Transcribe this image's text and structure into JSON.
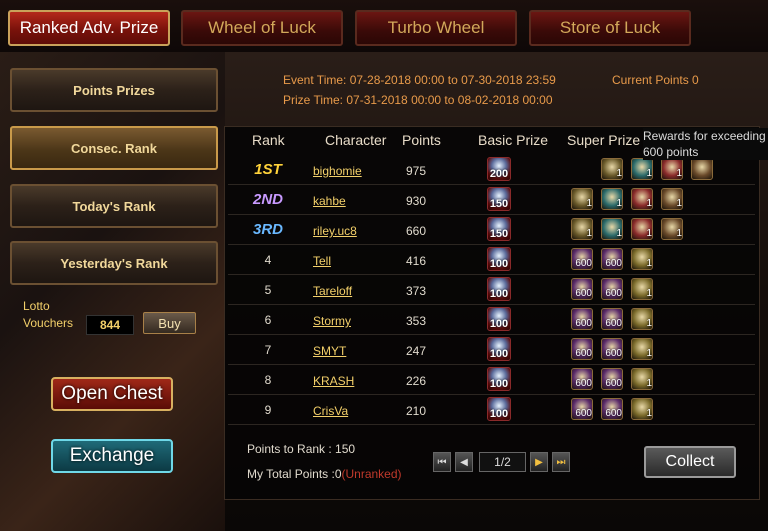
{
  "tabs": [
    "Ranked Adv. Prize",
    "Wheel of Luck",
    "Turbo Wheel",
    "Store of Luck"
  ],
  "side_menu": [
    "Points Prizes",
    "Consec. Rank",
    "Today's Rank",
    "Yesterday's Rank"
  ],
  "lotto": {
    "label_line1": "Lotto",
    "label_line2": "Vouchers",
    "value": "844",
    "buy_label": "Buy"
  },
  "buttons": {
    "open_chest": "Open Chest",
    "exchange": "Exchange",
    "collect": "Collect"
  },
  "event": {
    "event_time": "Event Time: 07-28-2018 00:00 to 07-30-2018 23:59",
    "prize_time": "Prize Time: 07-31-2018 00:00 to 08-02-2018 00:00",
    "current_points": "Current Points 0"
  },
  "table": {
    "headers": {
      "rank": "Rank",
      "character": "Character",
      "points": "Points",
      "basic": "Basic Prize",
      "super": "Super Prize"
    },
    "tooltip_line1": "Rewards for exceeding",
    "tooltip_line2": "600 points",
    "rows": [
      {
        "rank": "1ST",
        "name": "bighomie",
        "points": "975",
        "basic": "200",
        "super": [
          "1",
          "1",
          "1",
          ""
        ]
      },
      {
        "rank": "2ND",
        "name": "kahbe",
        "points": "930",
        "basic": "150",
        "super": [
          "1",
          "1",
          "1",
          "1"
        ]
      },
      {
        "rank": "3RD",
        "name": "riley.uc8",
        "points": "660",
        "basic": "150",
        "super": [
          "1",
          "1",
          "1",
          "1"
        ]
      },
      {
        "rank": "4",
        "name": "Tell",
        "points": "416",
        "basic": "100",
        "super": [
          "600",
          "600",
          "1"
        ]
      },
      {
        "rank": "5",
        "name": "Tareloff",
        "points": "373",
        "basic": "100",
        "super": [
          "600",
          "600",
          "1"
        ]
      },
      {
        "rank": "6",
        "name": "Stormy",
        "points": "353",
        "basic": "100",
        "super": [
          "600",
          "600",
          "1"
        ]
      },
      {
        "rank": "7",
        "name": "SMYT",
        "points": "247",
        "basic": "100",
        "super": [
          "600",
          "600",
          "1"
        ]
      },
      {
        "rank": "8",
        "name": "KRASH",
        "points": "226",
        "basic": "100",
        "super": [
          "600",
          "600",
          "1"
        ]
      },
      {
        "rank": "9",
        "name": "CrisVa",
        "points": "210",
        "basic": "100",
        "super": [
          "600",
          "600",
          "1"
        ]
      }
    ]
  },
  "footer": {
    "points_to_rank": "Points to Rank : 150",
    "my_total": "My Total Points :0",
    "unranked": "(Unranked)",
    "page": "1/2"
  },
  "colors": {
    "gold_text": "#f3d06a",
    "orange_text": "#e89a4a",
    "unranked": "#c0392b"
  }
}
